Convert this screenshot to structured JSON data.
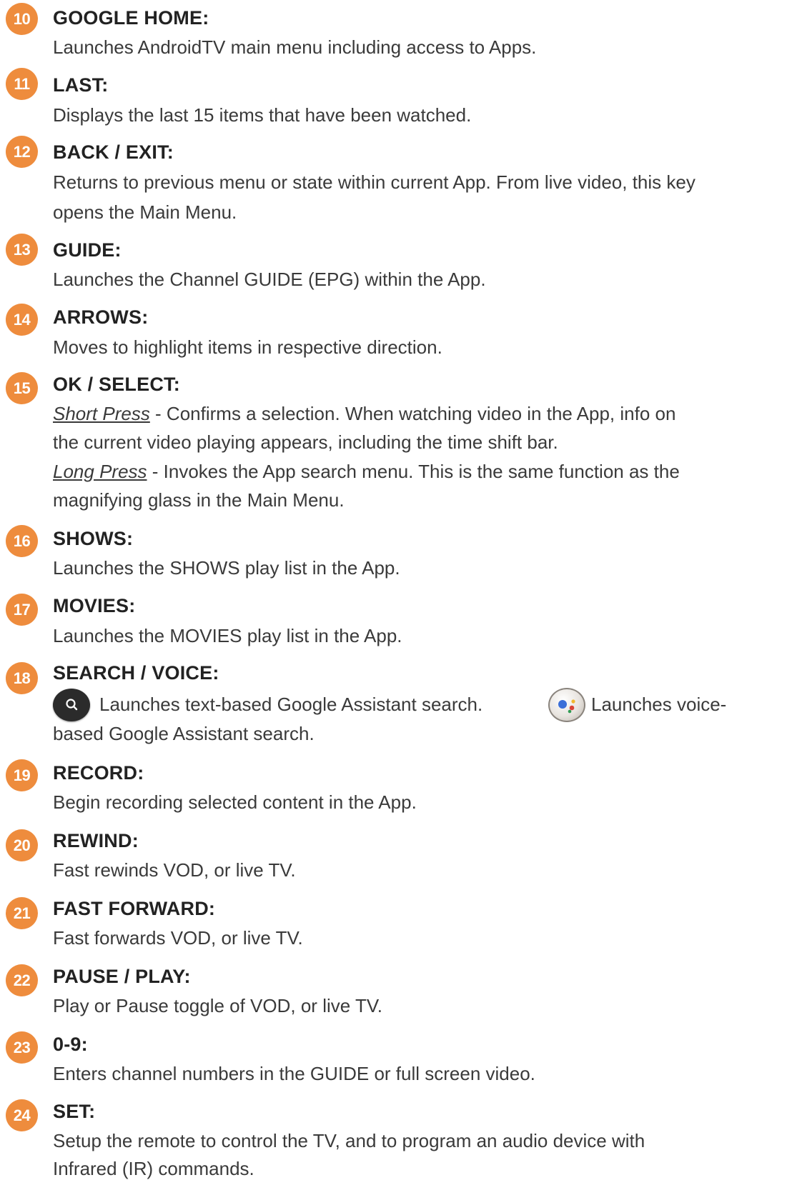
{
  "items": [
    {
      "number": "10",
      "title": "GOOGLE HOME:",
      "lines": [
        "Launches AndroidTV main menu including access to Apps."
      ]
    },
    {
      "number": "11",
      "title": "LAST:",
      "lines": [
        "Displays the last 15 items that have been watched."
      ]
    },
    {
      "number": "12",
      "title": "BACK / EXIT:",
      "lines": [
        "Returns to previous menu or state within current App. From live video, this key",
        "opens the Main Menu."
      ]
    },
    {
      "number": "13",
      "title": "GUIDE:",
      "lines": [
        "Launches the Channel GUIDE (EPG) within the App."
      ]
    },
    {
      "number": "14",
      "title": "ARROWS:",
      "lines": [
        "Moves to highlight items in respective direction."
      ]
    },
    {
      "number": "15",
      "title": "OK / SELECT:",
      "short_press_label": "Short Press",
      "short_press_line1": " - Confirms a selection. When watching video in the App, info on",
      "short_press_line2": "the current video playing appears, including the time shift bar.",
      "long_press_label": "Long Press",
      "long_press_line1": " - Invokes the App search menu. This is the same function as the",
      "long_press_line2": "magnifying glass in the Main Menu."
    },
    {
      "number": "16",
      "title": "SHOWS:",
      "lines": [
        "Launches the SHOWS play list in the App."
      ]
    },
    {
      "number": "17",
      "title": "MOVIES:",
      "lines": [
        "Launches the MOVIES play list in the App."
      ]
    },
    {
      "number": "18",
      "title": "SEARCH / VOICE:",
      "text_search": "Launches text-based Google Assistant search.",
      "voice_search_a": "Launches voice-",
      "voice_search_b": "based Google Assistant search.",
      "icons": [
        "search-icon",
        "google-assistant-icon"
      ]
    },
    {
      "number": "19",
      "title": "RECORD:",
      "lines": [
        "Begin recording selected content in the App."
      ]
    },
    {
      "number": "20",
      "title": "REWIND:",
      "lines": [
        "Fast rewinds VOD, or live TV."
      ]
    },
    {
      "number": "21",
      "title": "FAST FORWARD:",
      "lines": [
        "Fast forwards VOD, or live TV."
      ]
    },
    {
      "number": "22",
      "title": "PAUSE / PLAY:",
      "lines": [
        "Play or Pause toggle of VOD, or live TV."
      ]
    },
    {
      "number": "23",
      "title": "0-9:",
      "lines": [
        "Enters channel numbers in the GUIDE or full screen video."
      ]
    },
    {
      "number": "24",
      "title": "SET:",
      "lines": [
        "Setup the remote to control the TV, and to program an audio device with",
        "Infrared (IR) commands."
      ]
    }
  ],
  "colors": {
    "badge": "#ee8c3d",
    "heading": "#222222",
    "body_text": "#3a3a3a"
  }
}
